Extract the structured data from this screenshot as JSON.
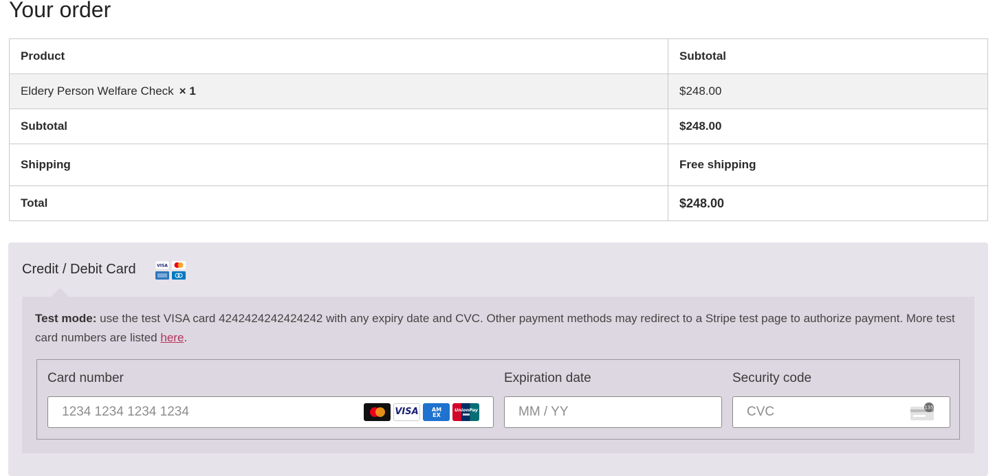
{
  "page": {
    "title": "Your order"
  },
  "order_table": {
    "headers": {
      "product": "Product",
      "subtotal": "Subtotal"
    },
    "item": {
      "name": "Eldery Person Welfare Check",
      "qty": "× 1",
      "price": "$248.00"
    },
    "subtotal": {
      "label": "Subtotal",
      "value": "$248.00"
    },
    "shipping": {
      "label": "Shipping",
      "value": "Free shipping"
    },
    "total": {
      "label": "Total",
      "value": "$248.00"
    }
  },
  "payment": {
    "method_label": "Credit / Debit Card",
    "accepted_card_icons": [
      "visa-icon",
      "mastercard-icon",
      "amex-icon",
      "diners-icon"
    ],
    "test_note": {
      "prefix": "Test mode:",
      "body": " use the test VISA card 4242424242424242 with any expiry date and CVC. Other payment methods may redirect to a Stripe test page to authorize payment. More test card numbers are listed ",
      "link": "here",
      "suffix": "."
    },
    "card_number": {
      "label": "Card number",
      "placeholder": "1234 1234 1234 1234",
      "brand_icons": [
        "mastercard-icon",
        "visa-icon",
        "amex-icon",
        "unionpay-icon"
      ]
    },
    "expiry": {
      "label": "Expiration date",
      "placeholder": "MM / YY"
    },
    "cvc": {
      "label": "Security code",
      "placeholder": "CVC",
      "icon_text": "135"
    },
    "colors": {
      "panel_bg": "#e7e3ea",
      "box_bg": "#ddd7e1",
      "link": "#b4345a"
    }
  }
}
